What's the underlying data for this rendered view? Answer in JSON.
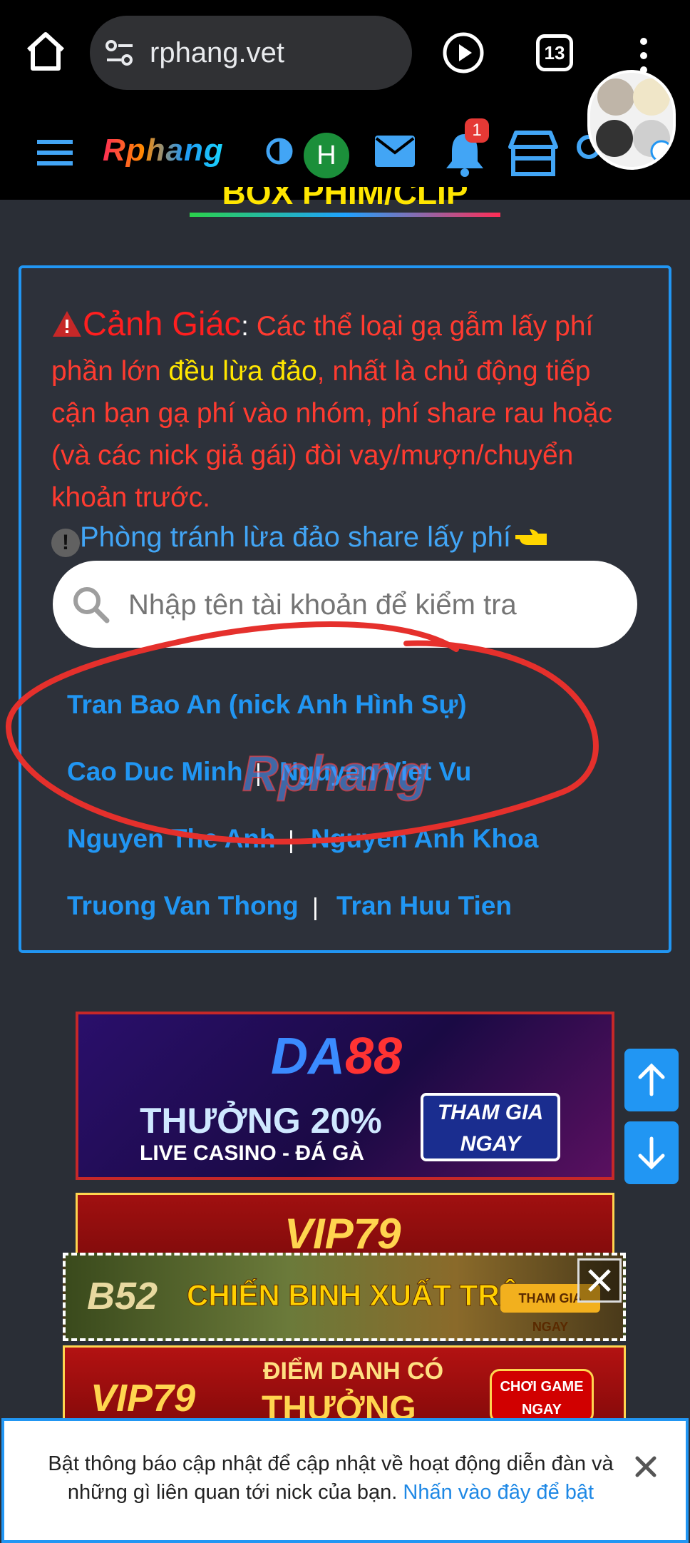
{
  "browser": {
    "url": "rphang.vet",
    "tab_count": "13"
  },
  "header": {
    "logo_text": "Rphang",
    "avatar_letter": "H",
    "notification_badge": "1"
  },
  "section": {
    "heading": "BOX PHIM/CLIP"
  },
  "warning": {
    "title": "Cảnh Giác",
    "colon": ":",
    "text_part1": " Các thể loại gạ gẫm lấy phí phần lớn ",
    "highlight": "đều lừa đảo",
    "text_part2": ", nhất là chủ động tiếp cận bạn gạ phí vào nhóm, phí share rau hoặc (và các nick giả gái) đòi vay/mượn/chuyển khoản trước.",
    "avoid_label": "Phòng tránh lừa đảo share lấy phí"
  },
  "search": {
    "placeholder": "Nhập tên tài khoản để kiểm tra"
  },
  "scammers": [
    {
      "name": "Tran Bao An (nick Anh Hình Sự)"
    },
    {
      "name": "Cao Duc Minh"
    },
    {
      "name": "Nguyen Viet Vu"
    },
    {
      "name": "Nguyen The Anh"
    },
    {
      "name": "Nguyen Anh Khoa"
    },
    {
      "name": "Truong Van Thong"
    },
    {
      "name": "Tran Huu Tien"
    }
  ],
  "separator": "|",
  "watermark": "Rphang",
  "ads": {
    "da88": {
      "brand_main": "DA",
      "brand_num": "88",
      "promo_line1": "THƯỞNG 20%",
      "promo_line2": "LIVE CASINO - ĐÁ GÀ",
      "cta_line1": "THAM GIA",
      "cta_line2": "NGAY"
    },
    "vip79_top": {
      "brand": "VIP79"
    },
    "b52": {
      "brand": "B52",
      "slogan": "CHIẾN BINH XUẤT TRẬN",
      "cta": "THAM GIA NGAY"
    },
    "vip79_bottom": {
      "brand": "VIP79",
      "line1": "ĐIỂM DANH CÓ",
      "line2": "THƯỞNG",
      "cta_line1": "CHƠI GAME",
      "cta_line2": "NGAY"
    }
  },
  "notification": {
    "text": "Bật thông báo cập nhật để cập nhật về hoạt động diễn đàn và những gì liên quan tới nick của bạn. ",
    "link": "Nhấn vào đây để bật"
  },
  "colors": {
    "accent": "#2196f3",
    "warning_red": "#ff3b30",
    "highlight_yellow": "#ffe600",
    "background": "#2a2e36"
  }
}
